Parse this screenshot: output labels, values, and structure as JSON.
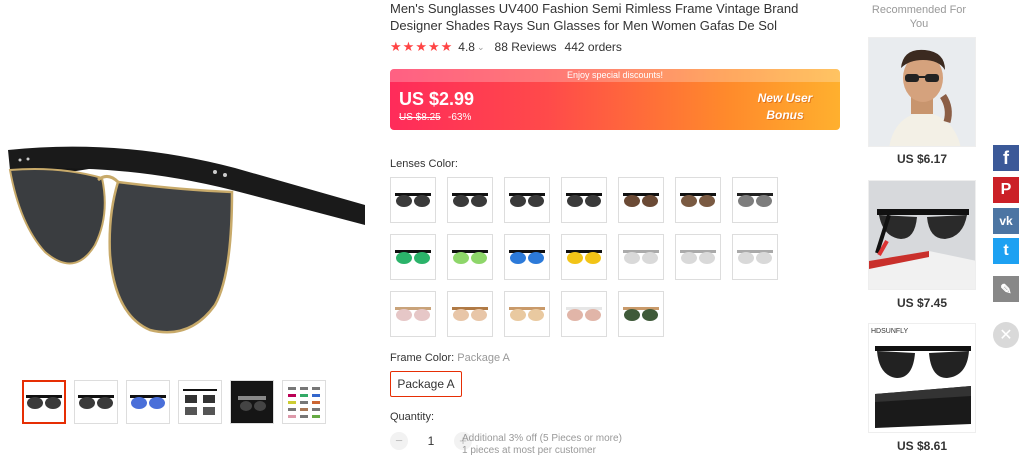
{
  "product": {
    "title": "Men's Sunglasses UV400 Fashion Semi Rimless Frame Vintage Brand Designer Shades Rays Sun Glasses for Men Women Gafas De Sol",
    "rating": "4.8",
    "rating_caret": "⌄",
    "reviews": "88 Reviews",
    "orders": "442 orders"
  },
  "price_banner": {
    "promo": "Enjoy special discounts!",
    "price": "US $2.99",
    "original_price": "US $8.25",
    "discount": "-63%",
    "new_user_line1": "New User",
    "new_user_line2": "Bonus"
  },
  "lenses": {
    "label": "Lenses Color:",
    "options": [
      {
        "lens": "#3a3a3a",
        "frame": "#111"
      },
      {
        "lens": "#3a3a3a",
        "frame": "#111"
      },
      {
        "lens": "#3a3a3a",
        "frame": "#111"
      },
      {
        "lens": "#3a3a3a",
        "frame": "#111"
      },
      {
        "lens": "#6b4a35",
        "frame": "#111"
      },
      {
        "lens": "#7a5a42",
        "frame": "#111"
      },
      {
        "lens": "#7d7d7d",
        "frame": "#222"
      },
      {
        "lens": "#2bb36a",
        "frame": "#111"
      },
      {
        "lens": "#8ed66a",
        "frame": "#111"
      },
      {
        "lens": "#2c7ad9",
        "frame": "#111"
      },
      {
        "lens": "#f2c417",
        "frame": "#111"
      },
      {
        "lens": "#d9d9d9",
        "frame": "#aaa"
      },
      {
        "lens": "#d9d9d9",
        "frame": "#aaa"
      },
      {
        "lens": "#d9d9d9",
        "frame": "#aaa"
      },
      {
        "lens": "#e6c7c7",
        "frame": "#c9a37a"
      },
      {
        "lens": "#e8c6a8",
        "frame": "#b07a45"
      },
      {
        "lens": "#e9c9a0",
        "frame": "#c99a6a"
      },
      {
        "lens": "#e1b5a8",
        "frame": "#e6e6e6"
      },
      {
        "lens": "#3f5a3a",
        "frame": "#c99a6a"
      }
    ]
  },
  "frame": {
    "label": "Frame Color:",
    "selected": "Package A",
    "option": "Package A"
  },
  "quantity": {
    "label": "Quantity:",
    "minus": "−",
    "value": "1",
    "plus": "+",
    "line1": "Additional 3% off (5 Pieces or more)",
    "line2": "1 pieces at most per customer"
  },
  "recommended": {
    "title": "Recommended For You",
    "items": [
      {
        "price": "US $6.17"
      },
      {
        "price": "US $7.45"
      },
      {
        "price": "US $8.61",
        "brand": "HDSUNFLY"
      }
    ]
  },
  "social": {
    "facebook": "f",
    "pinterest": "P",
    "vk": "vk",
    "twitter": "t",
    "edit": "✎",
    "close": "✕"
  },
  "colors": {
    "accent": "#e62e04",
    "facebook": "#3b5998",
    "pinterest": "#cb2027",
    "vk": "#4c75a3",
    "twitter": "#1da1f2",
    "edit": "#888888"
  }
}
